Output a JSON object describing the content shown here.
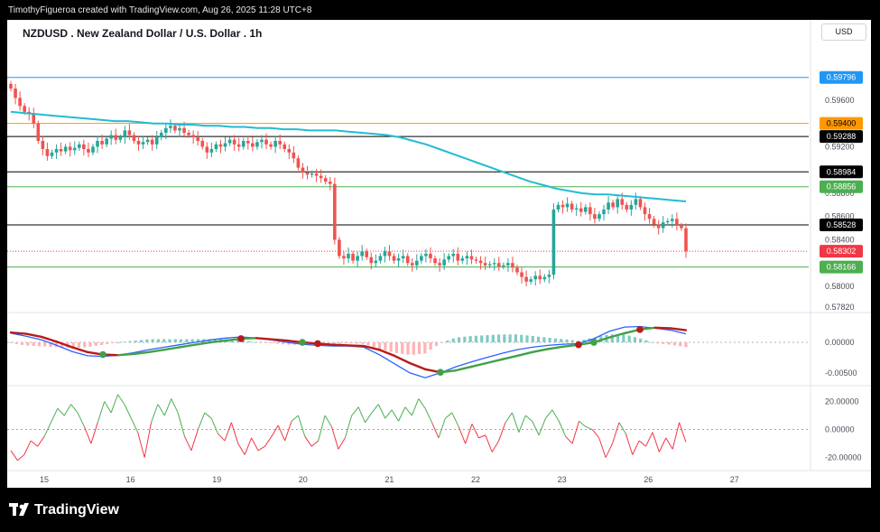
{
  "header": {
    "attribution": "TimothyFigueroa created with TradingView.com, Aug 26, 2025 11:28 UTC+8"
  },
  "title": "NZDUSD . New Zealand Dollar / U.S. Dollar . 1h",
  "currency": "USD",
  "footer": {
    "brand": "TradingView"
  },
  "colors": {
    "up": "#26a69a",
    "down": "#ef5350",
    "ma": "#22bcd2",
    "macd": "#2962ff",
    "signal_up": "#43a047",
    "signal_down": "#b71c1c"
  },
  "chart_data": [
    {
      "type": "candlestick",
      "panel": "price",
      "x_tick_labels": [
        "15",
        "16",
        "19",
        "20",
        "21",
        "22",
        "23",
        "26",
        "27"
      ],
      "y_tick_labels": [
        "0.59600",
        "0.59200",
        "0.58800",
        "0.58600",
        "0.58400",
        "0.58000",
        "0.57820"
      ],
      "ylim": [
        0.5779,
        0.5998
      ],
      "close_series": [
        0.597,
        0.5962,
        0.5955,
        0.595,
        0.5948,
        0.594,
        0.5925,
        0.5918,
        0.5912,
        0.5915,
        0.5918,
        0.5916,
        0.592,
        0.5917,
        0.5919,
        0.5922,
        0.5918,
        0.5915,
        0.592,
        0.5925,
        0.5922,
        0.5927,
        0.593,
        0.5926,
        0.5928,
        0.5934,
        0.593,
        0.5925,
        0.5922,
        0.5924,
        0.5926,
        0.5922,
        0.5928,
        0.5932,
        0.5936,
        0.5938,
        0.5934,
        0.5936,
        0.5932,
        0.593,
        0.5928,
        0.5925,
        0.592,
        0.5915,
        0.5918,
        0.5922,
        0.592,
        0.5923,
        0.5926,
        0.5922,
        0.592,
        0.5925,
        0.5923,
        0.592,
        0.5924,
        0.5926,
        0.5922,
        0.592,
        0.5925,
        0.5922,
        0.5918,
        0.5915,
        0.591,
        0.5902,
        0.5898,
        0.5896,
        0.5897,
        0.5895,
        0.5893,
        0.589,
        0.5888,
        0.584,
        0.5826,
        0.5824,
        0.5828,
        0.5822,
        0.5826,
        0.583,
        0.5825,
        0.582,
        0.5822,
        0.5826,
        0.583,
        0.5826,
        0.5822,
        0.5824,
        0.5826,
        0.582,
        0.5818,
        0.5822,
        0.5826,
        0.5828,
        0.5824,
        0.582,
        0.5818,
        0.5823,
        0.5826,
        0.5828,
        0.5822,
        0.5824,
        0.5826,
        0.5823,
        0.5822,
        0.582,
        0.5818,
        0.5819,
        0.582,
        0.5817,
        0.5818,
        0.582,
        0.5816,
        0.5812,
        0.5808,
        0.5804,
        0.5806,
        0.5809,
        0.5806,
        0.5808,
        0.581,
        0.5866,
        0.587,
        0.5868,
        0.5871,
        0.5866,
        0.5867,
        0.5864,
        0.5868,
        0.5862,
        0.5858,
        0.5862,
        0.5866,
        0.5872,
        0.5868,
        0.5875,
        0.587,
        0.5866,
        0.587,
        0.5875,
        0.5868,
        0.5862,
        0.5858,
        0.5853,
        0.585,
        0.5855,
        0.5856,
        0.5858,
        0.5852,
        0.585,
        0.583
      ],
      "ma_series": [
        0.595,
        0.5949,
        0.5948,
        0.5947,
        0.5946,
        0.5945,
        0.5944,
        0.5943,
        0.5942,
        0.5942,
        0.5941,
        0.594,
        0.594,
        0.5939,
        0.5939,
        0.5938,
        0.5938,
        0.5937,
        0.5937,
        0.5936,
        0.5936,
        0.5935,
        0.5935,
        0.5934,
        0.5934,
        0.5934,
        0.5933,
        0.5932,
        0.5931,
        0.593,
        0.5928,
        0.5925,
        0.5922,
        0.5918,
        0.5914,
        0.591,
        0.5906,
        0.5902,
        0.5898,
        0.5894,
        0.589,
        0.5887,
        0.5884,
        0.5882,
        0.588,
        0.5879,
        0.5879,
        0.5878,
        0.5877,
        0.5876,
        0.5875,
        0.5874,
        0.5873
      ],
      "horizontal_levels": [
        {
          "value": "0.59796",
          "color": "#2196f3",
          "text_color": "#ffffff",
          "line": "solid"
        },
        {
          "value": "0.59400",
          "color": "#ff9800",
          "text_color": "#000000",
          "line": "solid"
        },
        {
          "value": "0.59288",
          "color": "#000000",
          "text_color": "#ffffff",
          "line": "solid"
        },
        {
          "value": "0.58984",
          "color": "#000000",
          "text_color": "#ffffff",
          "line": "solid"
        },
        {
          "value": "0.58856",
          "color": "#4caf50",
          "text_color": "#ffffff",
          "line": "solid"
        },
        {
          "value": "0.58528",
          "color": "#000000",
          "text_color": "#ffffff",
          "line": "solid"
        },
        {
          "value": "0.58302",
          "color": "#f23645",
          "text_color": "#ffffff",
          "line": "dotted"
        },
        {
          "value": "0.58166",
          "color": "#4caf50",
          "text_color": "#ffffff",
          "line": "solid"
        }
      ]
    },
    {
      "type": "line",
      "panel": "macd",
      "y_tick_labels": [
        "0.00000",
        "-0.00500"
      ],
      "ylim": [
        -0.0068,
        0.004
      ],
      "series": [
        {
          "values": [
            0.0015,
            0.001,
            0.0004,
            -0.0005,
            -0.0015,
            -0.0022,
            -0.0023,
            -0.0021,
            -0.0017,
            -0.0012,
            -0.0008,
            -0.0004,
            0.0,
            0.0004,
            0.0007,
            0.0009,
            0.0007,
            0.0004,
            0.0,
            -0.0003,
            -0.0005,
            -0.0006,
            -0.0006,
            -0.0008,
            -0.002,
            -0.0035,
            -0.005,
            -0.0058,
            -0.005,
            -0.004,
            -0.0032,
            -0.0025,
            -0.0018,
            -0.0012,
            -0.0008,
            -0.0005,
            -0.0003,
            -0.0002,
            0.0006,
            0.0018,
            0.0025,
            0.0026,
            0.0023,
            0.002,
            0.0014
          ]
        },
        {
          "values": [
            0.0016,
            0.0014,
            0.0009,
            0.0001,
            -0.0008,
            -0.0016,
            -0.002,
            -0.0021,
            -0.0019,
            -0.0016,
            -0.0012,
            -0.0008,
            -0.0004,
            0.0,
            0.0003,
            0.0006,
            0.0007,
            0.0005,
            0.0003,
            0.0,
            -0.0002,
            -0.0004,
            -0.0005,
            -0.0006,
            -0.0012,
            -0.0022,
            -0.0034,
            -0.0044,
            -0.0049,
            -0.0046,
            -0.004,
            -0.0034,
            -0.0028,
            -0.0022,
            -0.0016,
            -0.0011,
            -0.0007,
            -0.0004,
            0.0,
            0.0008,
            0.0015,
            0.0021,
            0.0024,
            0.0023,
            0.002
          ]
        }
      ],
      "cross_markers": [
        {
          "index": 6,
          "color": "#43a047"
        },
        {
          "index": 15,
          "color": "#b71c1c"
        },
        {
          "index": 19,
          "color": "#43a047"
        },
        {
          "index": 20,
          "color": "#b71c1c"
        },
        {
          "index": 28,
          "color": "#43a047"
        },
        {
          "index": 37,
          "color": "#b71c1c"
        },
        {
          "index": 38,
          "color": "#43a047"
        },
        {
          "index": 41,
          "color": "#b71c1c"
        }
      ]
    },
    {
      "type": "line",
      "panel": "oscillator",
      "y_tick_labels": [
        "20.00000",
        "0.00000",
        "-20.00000"
      ],
      "ylim": [
        -28,
        30
      ],
      "series": [
        {
          "values": [
            -15,
            -22,
            -18,
            -8,
            -12,
            -5,
            5,
            15,
            10,
            18,
            12,
            2,
            -10,
            5,
            20,
            12,
            25,
            18,
            8,
            -2,
            -20,
            5,
            18,
            10,
            22,
            12,
            -5,
            -15,
            0,
            12,
            8,
            -3,
            -8,
            5,
            -10,
            -18,
            -6,
            -15,
            -12,
            -5,
            3,
            -8,
            6,
            10,
            -5,
            -12,
            -8,
            10,
            2,
            -14,
            -6,
            10,
            16,
            5,
            12,
            18,
            8,
            14,
            6,
            16,
            10,
            22,
            15,
            5,
            -6,
            8,
            12,
            2,
            -10,
            4,
            -6,
            -4,
            -16,
            -8,
            5,
            12,
            -2,
            10,
            6,
            -4,
            8,
            14,
            6,
            -5,
            -10,
            6,
            2,
            0,
            -6,
            -20,
            -10,
            5,
            -3,
            -18,
            -8,
            -12,
            -2,
            -16,
            -6,
            -14,
            5,
            -9
          ]
        }
      ]
    }
  ]
}
